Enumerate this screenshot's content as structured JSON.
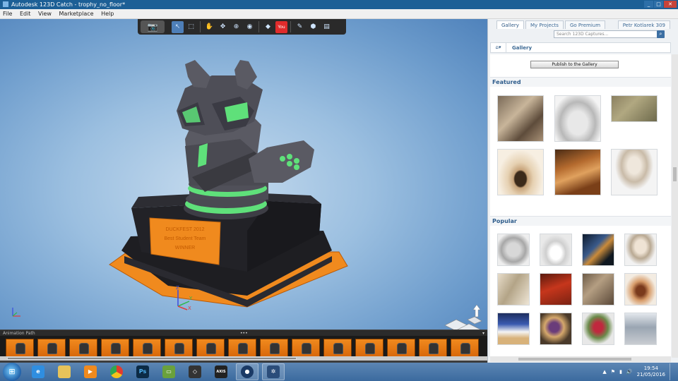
{
  "window": {
    "title": "Autodesk 123D Catch - trophy_no_floor*",
    "controls": [
      "_",
      "□",
      "✕"
    ]
  },
  "menu": [
    "File",
    "Edit",
    "View",
    "Marketplace",
    "Help"
  ],
  "toolbar_icons": [
    "camera-icon",
    "select-icon",
    "lasso-icon",
    "orbit-icon",
    "pan-icon",
    "zoom-icon",
    "camera-capture-icon",
    "mesh-icon",
    "youtube-icon",
    "measure-icon",
    "export-icon",
    "share-icon"
  ],
  "youtube_label": "You",
  "trophy": {
    "plaque_line1": "DUCKFEST 2012",
    "plaque_line2": "Best Student Team",
    "plaque_line3": "WINNER"
  },
  "animation_path": {
    "label": "Animation Path",
    "dots": "•••",
    "frames": 15
  },
  "gallery": {
    "tabs": [
      "Gallery",
      "My Projects",
      "Go Premium"
    ],
    "user": "Petr Kotlarek 309",
    "search_placeholder": "Search 123D Captures...",
    "crumb": "Gallery",
    "publish_label": "Publish to the Gallery",
    "featured_title": "Featured",
    "popular_title": "Popular",
    "featured_items": [
      "cat",
      "white sculpture",
      "creature on rocks",
      "cake on plate",
      "bread",
      "bust"
    ],
    "popular_items": [
      "white figure",
      "toy dog",
      "dark creature",
      "bust",
      "clay figure",
      "red object",
      "cat",
      "cake",
      "blue-white object",
      "croissant",
      "sculpture",
      "flowers"
    ]
  },
  "taskbar": {
    "apps": [
      "Internet Explorer",
      "File Explorer",
      "Media Player",
      "Chrome",
      "Photoshop",
      "Remote Desktop",
      "Unity",
      "AXIS",
      "Cinema 4D",
      "123D Catch"
    ],
    "ps_label": "Ps",
    "axis_label": "AXIS",
    "time": "19:54",
    "date": "21/05/2016"
  },
  "colors": {
    "titlebar": "#1c5f96",
    "accent_orange": "#f08a1e",
    "trophy_green": "#5fe07a",
    "link_blue": "#2f5a86"
  }
}
